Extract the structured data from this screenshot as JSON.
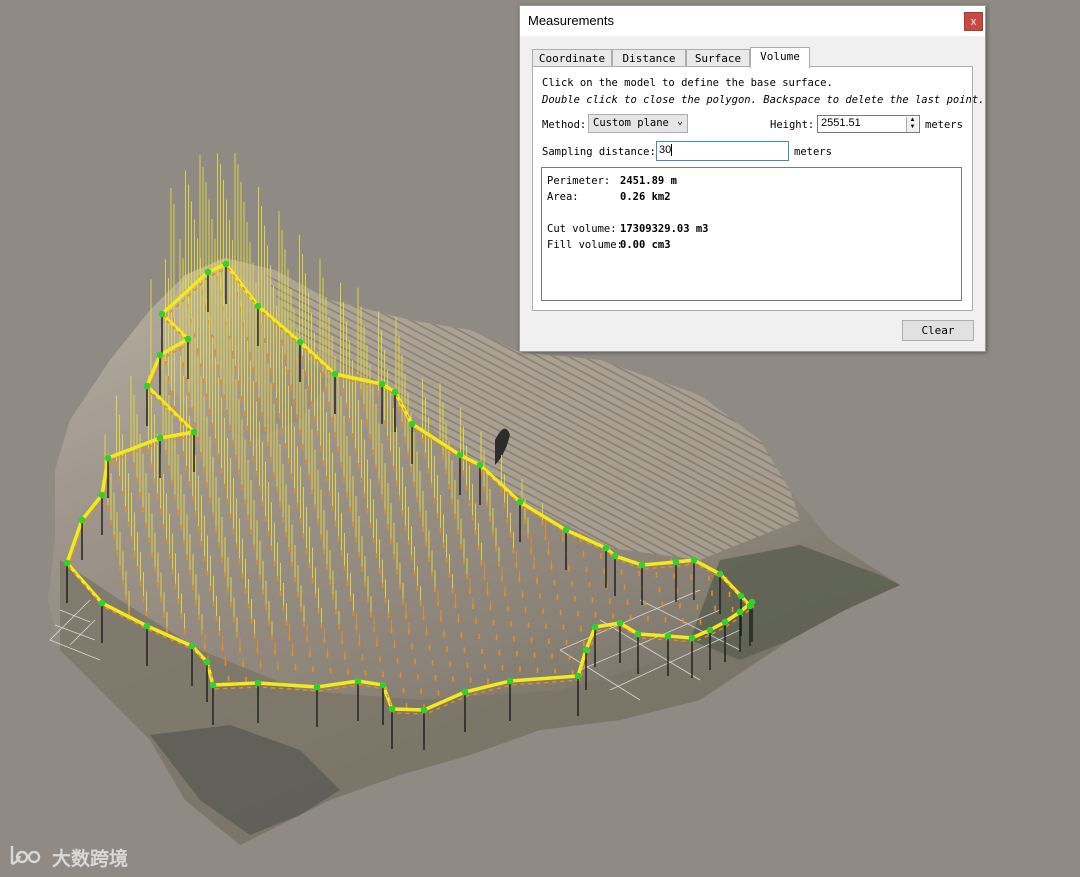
{
  "window": {
    "title": "Measurements",
    "close_label": "x"
  },
  "tabs": [
    {
      "label": "Coordinate",
      "active": false
    },
    {
      "label": "Distance",
      "active": false
    },
    {
      "label": "Surface",
      "active": false
    },
    {
      "label": "Volume",
      "active": true
    }
  ],
  "panel": {
    "instruction_1": "Click on the model to define the base surface.",
    "instruction_2": "Double click to close the polygon. Backspace to delete the last point.",
    "method_label": "Method:",
    "method_value": "Custom plane",
    "height_label": "Height:",
    "height_value": "2551.51",
    "height_unit": "meters",
    "sampling_label": "Sampling distance:",
    "sampling_value": "30",
    "sampling_unit": "meters"
  },
  "results": {
    "perimeter_label": "Perimeter:",
    "perimeter_value": "2451.89 m",
    "area_label": "Area:",
    "area_value": "0.26 km2",
    "cut_label": "Cut volume:",
    "cut_value": "17309329.03 m3",
    "fill_label": "Fill volume:",
    "fill_value": "0.00 cm3"
  },
  "clear_label": "Clear",
  "watermark_text": "大数跨境",
  "colors": {
    "background": "#8f8a84",
    "polygon_line": "#f2ea1a",
    "vertex_marker": "#2fd12a",
    "sample_line": "#e6dc3a",
    "sample_marker": "#f08a1e",
    "close_button": "#c9483f"
  }
}
